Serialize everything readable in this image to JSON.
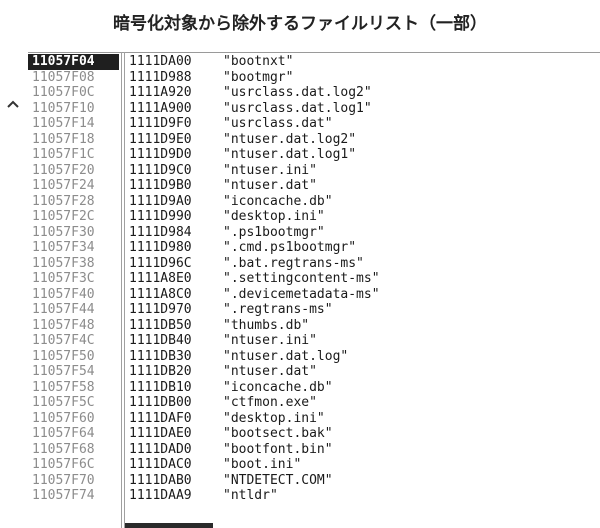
{
  "caption": "暗号化対象から除外するファイルリスト（一部）",
  "rows": [
    {
      "addr": "11057F04",
      "val": "1111DA00",
      "str": "\"bootnxt\""
    },
    {
      "addr": "11057F08",
      "val": "1111D988",
      "str": "\"bootmgr\""
    },
    {
      "addr": "11057F0C",
      "val": "1111A920",
      "str": "\"usrclass.dat.log2\""
    },
    {
      "addr": "11057F10",
      "val": "1111A900",
      "str": "\"usrclass.dat.log1\""
    },
    {
      "addr": "11057F14",
      "val": "1111D9F0",
      "str": "\"usrclass.dat\""
    },
    {
      "addr": "11057F18",
      "val": "1111D9E0",
      "str": "\"ntuser.dat.log2\""
    },
    {
      "addr": "11057F1C",
      "val": "1111D9D0",
      "str": "\"ntuser.dat.log1\""
    },
    {
      "addr": "11057F20",
      "val": "1111D9C0",
      "str": "\"ntuser.ini\""
    },
    {
      "addr": "11057F24",
      "val": "1111D9B0",
      "str": "\"ntuser.dat\""
    },
    {
      "addr": "11057F28",
      "val": "1111D9A0",
      "str": "\"iconcache.db\""
    },
    {
      "addr": "11057F2C",
      "val": "1111D990",
      "str": "\"desktop.ini\""
    },
    {
      "addr": "11057F30",
      "val": "1111D984",
      "str": "\".ps1bootmgr\""
    },
    {
      "addr": "11057F34",
      "val": "1111D980",
      "str": "\".cmd.ps1bootmgr\""
    },
    {
      "addr": "11057F38",
      "val": "1111D96C",
      "str": "\".bat.regtrans-ms\""
    },
    {
      "addr": "11057F3C",
      "val": "1111A8E0",
      "str": "\".settingcontent-ms\""
    },
    {
      "addr": "11057F40",
      "val": "1111A8C0",
      "str": "\".devicemetadata-ms\""
    },
    {
      "addr": "11057F44",
      "val": "1111D970",
      "str": "\".regtrans-ms\""
    },
    {
      "addr": "11057F48",
      "val": "1111DB50",
      "str": "\"thumbs.db\""
    },
    {
      "addr": "11057F4C",
      "val": "1111DB40",
      "str": "\"ntuser.ini\""
    },
    {
      "addr": "11057F50",
      "val": "1111DB30",
      "str": "\"ntuser.dat.log\""
    },
    {
      "addr": "11057F54",
      "val": "1111DB20",
      "str": "\"ntuser.dat\""
    },
    {
      "addr": "11057F58",
      "val": "1111DB10",
      "str": "\"iconcache.db\""
    },
    {
      "addr": "11057F5C",
      "val": "1111DB00",
      "str": "\"ctfmon.exe\""
    },
    {
      "addr": "11057F60",
      "val": "1111DAF0",
      "str": "\"desktop.ini\""
    },
    {
      "addr": "11057F64",
      "val": "1111DAE0",
      "str": "\"bootsect.bak\""
    },
    {
      "addr": "11057F68",
      "val": "1111DAD0",
      "str": "\"bootfont.bin\""
    },
    {
      "addr": "11057F6C",
      "val": "1111DAC0",
      "str": "\"boot.ini\""
    },
    {
      "addr": "11057F70",
      "val": "1111DAB0",
      "str": "\"NTDETECT.COM\""
    },
    {
      "addr": "11057F74",
      "val": "1111DAA9",
      "str": "\"ntldr\""
    }
  ],
  "selected_index": 0,
  "icons": {
    "scroll_up": "chevron-up-icon"
  },
  "colors": {
    "selected_bg": "#1f1f1f",
    "address_text": "#8c8c8c",
    "value_text": "#1a1a1a"
  }
}
